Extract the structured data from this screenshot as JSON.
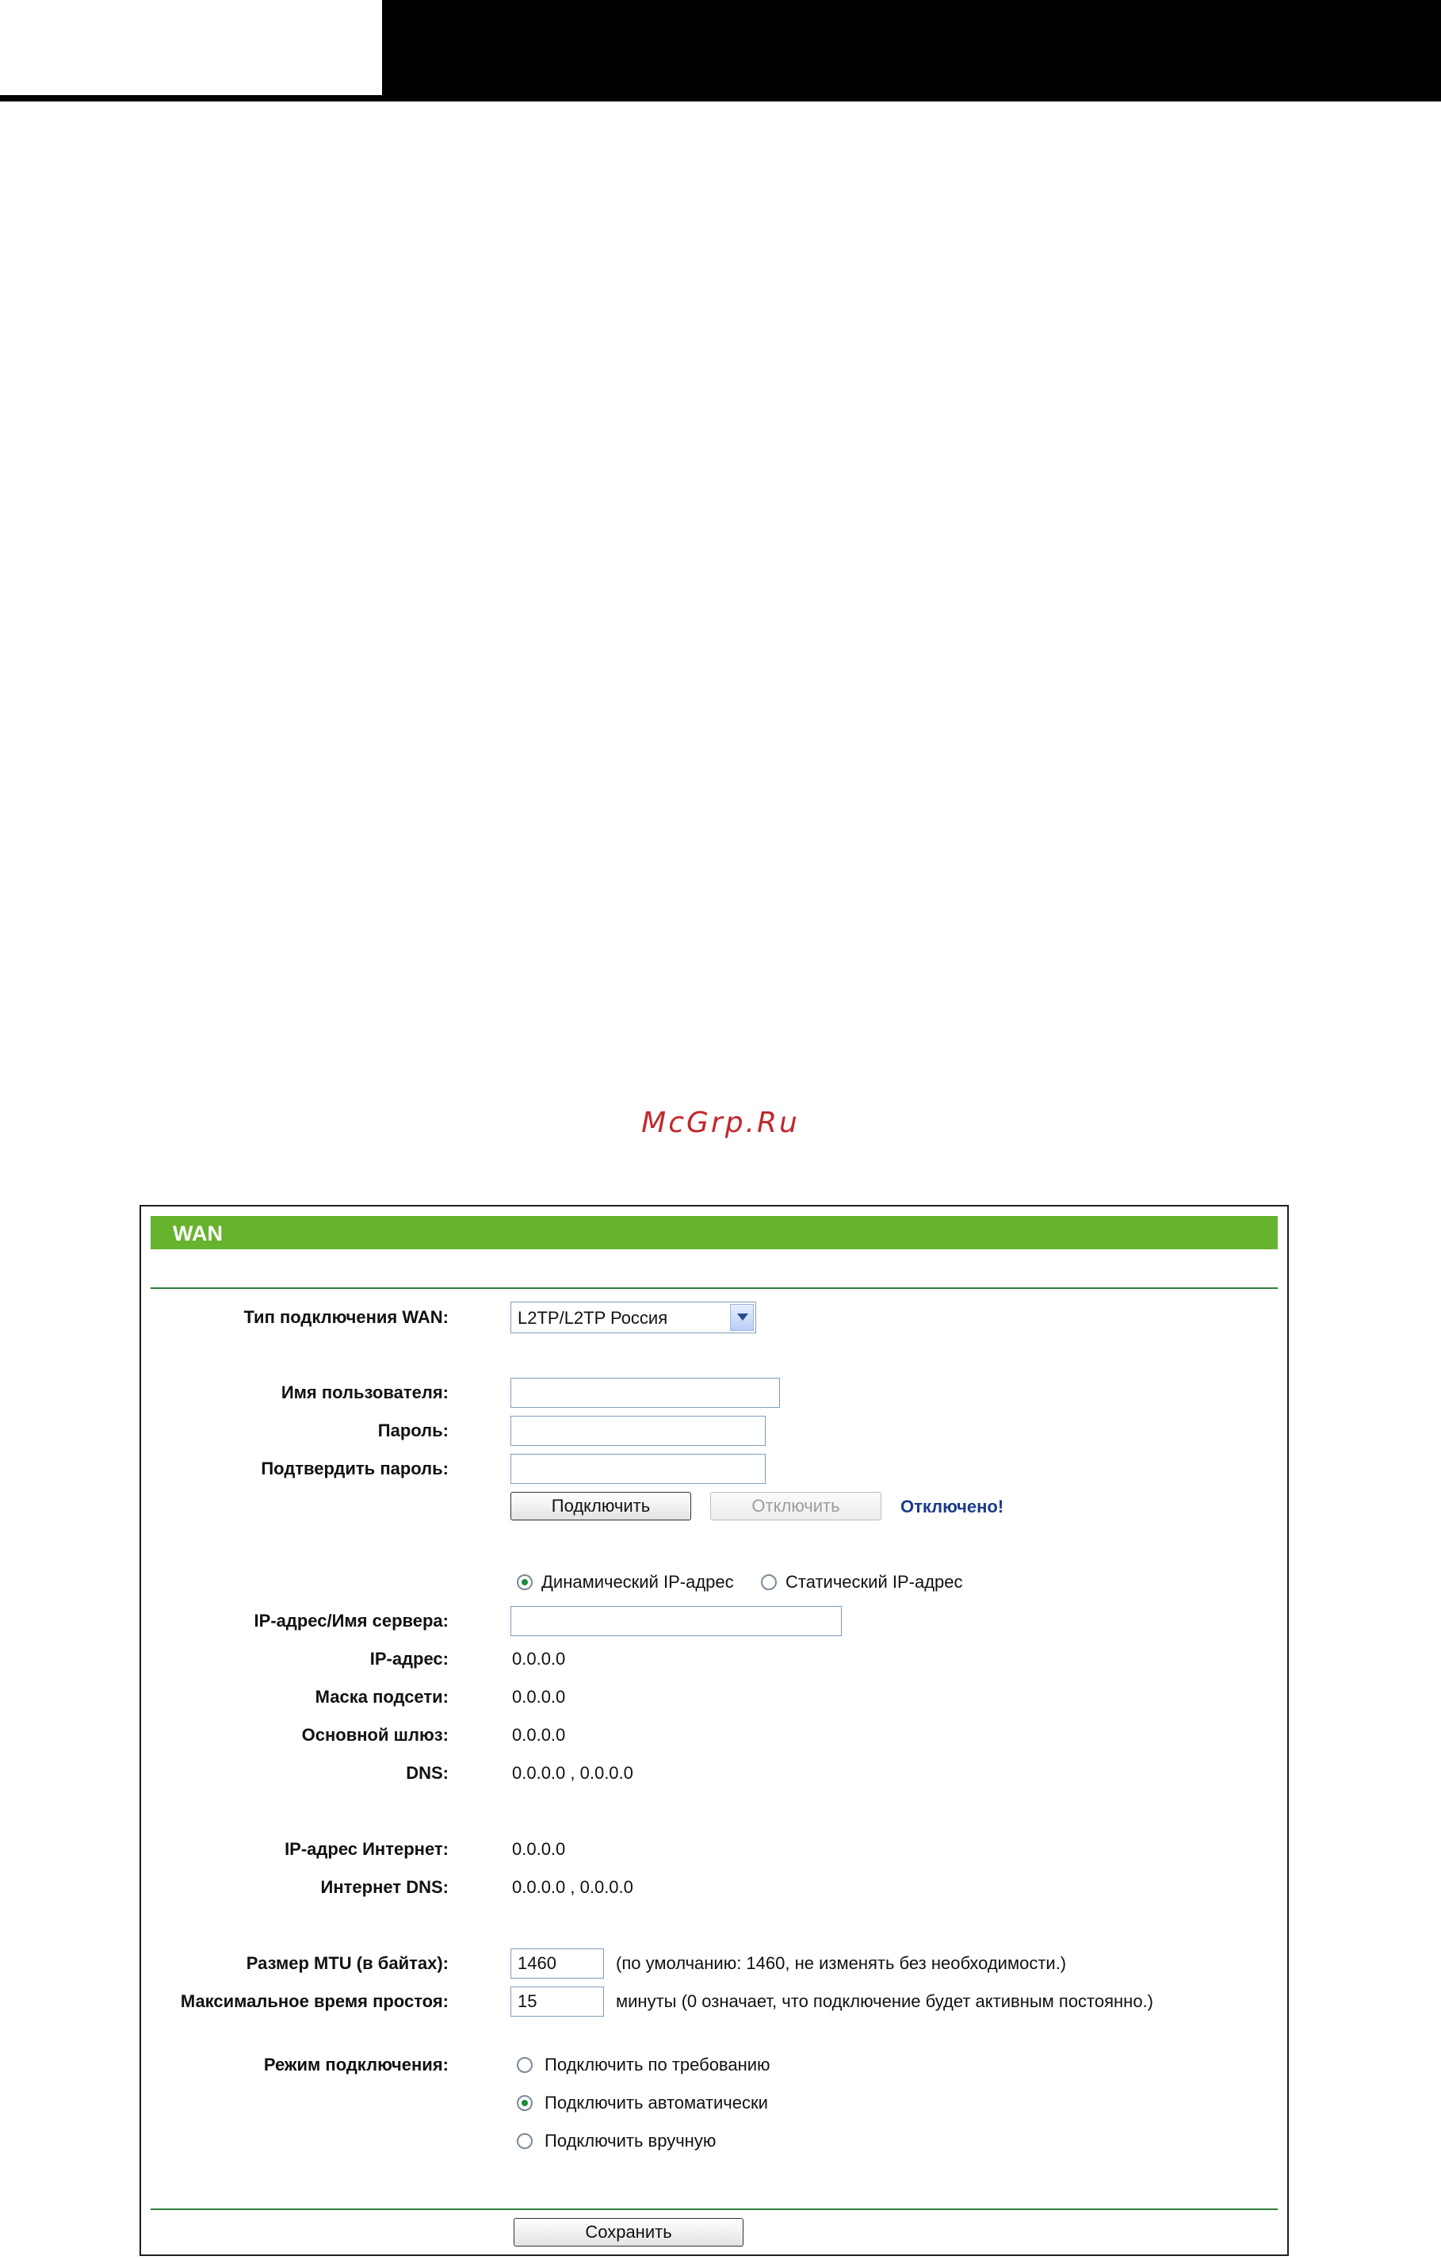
{
  "watermark": "McGrp.Ru",
  "panel": {
    "title": "WAN",
    "wan_type": {
      "label": "Тип подключения WAN:",
      "selected": "L2TP/L2TP Россия"
    },
    "username": {
      "label": "Имя пользователя:",
      "value": ""
    },
    "password": {
      "label": "Пароль:",
      "value": ""
    },
    "confirm_password": {
      "label": "Подтвердить пароль:",
      "value": ""
    },
    "connect_label": "Подключить",
    "disconnect_label": "Отключить",
    "status": "Отключено!",
    "ip_mode": {
      "dynamic": "Динамический IP-адрес",
      "static": "Статический IP-адрес",
      "selected": "dynamic"
    },
    "server": {
      "label": "IP-адрес/Имя сервера:",
      "value": ""
    },
    "ip": {
      "label": "IP-адрес:",
      "value": "0.0.0.0"
    },
    "mask": {
      "label": "Маска подсети:",
      "value": "0.0.0.0"
    },
    "gateway": {
      "label": "Основной шлюз:",
      "value": "0.0.0.0"
    },
    "dns": {
      "label": "DNS:",
      "value": "0.0.0.0 , 0.0.0.0"
    },
    "internet_ip": {
      "label": "IP-адрес Интернет:",
      "value": "0.0.0.0"
    },
    "internet_dns": {
      "label": "Интернет DNS:",
      "value": "0.0.0.0 , 0.0.0.0"
    },
    "mtu": {
      "label": "Размер MTU (в байтах):",
      "value": "1460",
      "hint": "(по умолчанию: 1460, не изменять без необходимости.)"
    },
    "idle": {
      "label": "Максимальное время простоя:",
      "value": "15",
      "hint": "минуты (0 означает, что подключение будет активным постоянно.)"
    },
    "mode": {
      "label": "Режим подключения:",
      "options": [
        "Подключить по требованию",
        "Подключить автоматически",
        "Подключить вручную"
      ],
      "selected_index": 1
    },
    "save_label": "Сохранить"
  }
}
